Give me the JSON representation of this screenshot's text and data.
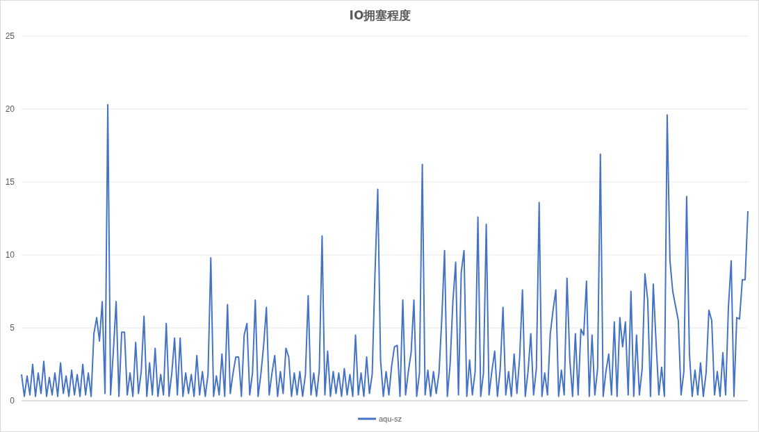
{
  "chart": {
    "chart_data": {
      "type": "line",
      "title": "IO拥塞程度",
      "grid": true,
      "ylim": [
        0,
        25
      ],
      "yticks": [
        0,
        5,
        10,
        15,
        20,
        25
      ],
      "series": [
        {
          "name": "aqu-sz",
          "color": "#4472c4",
          "values": [
            1.8,
            0.3,
            1.7,
            0.4,
            2.5,
            0.3,
            1.9,
            0.5,
            2.7,
            0.3,
            1.6,
            0.4,
            1.9,
            0.3,
            2.6,
            0.5,
            1.7,
            0.3,
            2.1,
            0.4,
            1.8,
            0.3,
            2.5,
            0.4,
            1.9,
            0.3,
            4.6,
            5.7,
            4.1,
            6.8,
            0.5,
            20.3,
            0.4,
            3.4,
            6.8,
            0.3,
            4.7,
            4.7,
            0.4,
            1.9,
            0.3,
            4.0,
            0.5,
            2.0,
            5.8,
            0.3,
            2.6,
            0.4,
            3.6,
            0.3,
            1.8,
            0.4,
            5.3,
            0.3,
            1.9,
            4.3,
            0.4,
            4.3,
            0.3,
            1.9,
            0.5,
            1.8,
            0.3,
            3.1,
            0.4,
            2.0,
            0.3,
            1.8,
            9.8,
            0.3,
            1.7,
            0.4,
            3.2,
            0.3,
            6.6,
            0.5,
            1.9,
            3.0,
            3.0,
            0.3,
            4.5,
            5.3,
            0.4,
            1.9,
            6.9,
            0.3,
            1.8,
            3.8,
            6.4,
            0.4,
            1.9,
            3.1,
            0.3,
            2.0,
            0.5,
            3.6,
            3.0,
            0.3,
            1.9,
            0.4,
            2.0,
            0.3,
            1.8,
            7.2,
            0.4,
            1.9,
            0.3,
            2.1,
            11.3,
            0.4,
            3.4,
            0.3,
            2.0,
            0.5,
            1.9,
            0.3,
            2.2,
            0.4,
            1.8,
            0.3,
            4.5,
            0.4,
            1.9,
            0.3,
            3.0,
            0.5,
            1.8,
            8.7,
            14.5,
            2.8,
            0.3,
            2.0,
            0.4,
            2.4,
            3.7,
            3.8,
            0.3,
            6.9,
            0.4,
            2.0,
            3.3,
            6.9,
            0.3,
            1.9,
            16.2,
            0.4,
            2.1,
            0.3,
            2.0,
            0.5,
            1.9,
            5.6,
            10.3,
            0.3,
            2.5,
            6.8,
            9.5,
            0.4,
            8.8,
            10.3,
            0.3,
            2.8,
            0.4,
            2.0,
            12.6,
            0.3,
            1.9,
            12.1,
            0.4,
            2.0,
            3.4,
            0.3,
            2.2,
            6.4,
            0.4,
            2.0,
            0.3,
            3.2,
            0.5,
            3.0,
            7.6,
            0.3,
            2.0,
            4.6,
            0.4,
            2.2,
            13.6,
            0.3,
            1.9,
            0.4,
            4.6,
            6.2,
            7.6,
            0.3,
            2.1,
            0.4,
            8.4,
            2.8,
            0.3,
            4.6,
            0.4,
            4.9,
            4.5,
            8.2,
            0.3,
            4.5,
            0.4,
            2.2,
            16.9,
            0.3,
            2.0,
            3.2,
            0.4,
            5.4,
            0.3,
            5.7,
            3.7,
            5.4,
            0.4,
            7.5,
            0.3,
            4.5,
            0.4,
            2.2,
            8.7,
            6.9,
            0.3,
            8.0,
            4.0,
            0.4,
            2.3,
            0.3,
            19.6,
            9.6,
            7.5,
            6.5,
            5.5,
            0.4,
            2.0,
            14.0,
            3.2,
            0.3,
            2.1,
            0.4,
            2.6,
            0.3,
            1.9,
            6.2,
            5.5,
            0.4,
            2.0,
            0.3,
            3.3,
            0.4,
            6.4,
            9.6,
            0.3,
            5.7,
            5.6,
            8.3,
            8.3,
            13.0
          ]
        }
      ]
    }
  }
}
